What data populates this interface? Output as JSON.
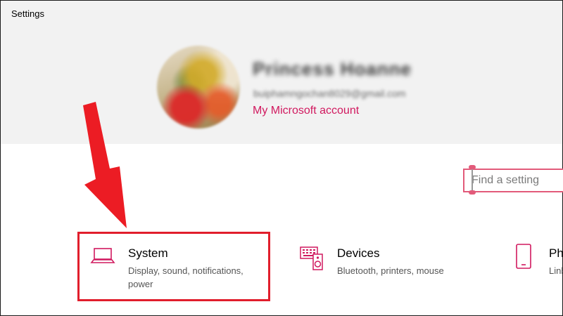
{
  "window": {
    "title": "Settings"
  },
  "profile": {
    "name": "Princess Hoanne",
    "email": "buiphamngochan8029@gmail.com",
    "account_link": "My Microsoft account"
  },
  "search": {
    "placeholder": "Find a setting"
  },
  "categories": [
    {
      "label": "System",
      "description": "Display, sound, notifications, power",
      "icon": "laptop-icon"
    },
    {
      "label": "Devices",
      "description": "Bluetooth, printers, mouse",
      "icon": "keyboard-speaker-icon"
    },
    {
      "label": "Pho",
      "description": "Link",
      "icon": "phone-icon"
    }
  ],
  "colors": {
    "accent": "#d1195f",
    "highlight": "#e11e2c",
    "header_bg": "#f2f2f2"
  }
}
